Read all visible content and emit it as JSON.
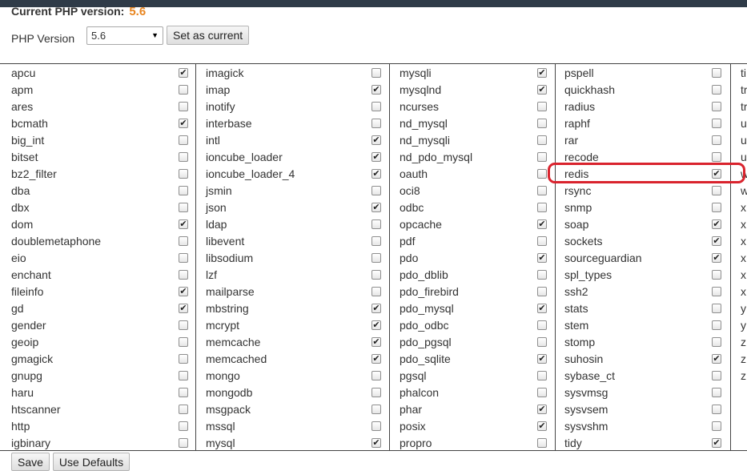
{
  "header": {
    "current_label": "Current PHP version:",
    "current_version": "5.6"
  },
  "selector": {
    "label": "PHP Version",
    "selected": "5.6",
    "set_button": "Set as current"
  },
  "columns": [
    [
      {
        "name": "apcu",
        "checked": true
      },
      {
        "name": "apm",
        "checked": false
      },
      {
        "name": "ares",
        "checked": false
      },
      {
        "name": "bcmath",
        "checked": true
      },
      {
        "name": "big_int",
        "checked": false
      },
      {
        "name": "bitset",
        "checked": false
      },
      {
        "name": "bz2_filter",
        "checked": false
      },
      {
        "name": "dba",
        "checked": false
      },
      {
        "name": "dbx",
        "checked": false
      },
      {
        "name": "dom",
        "checked": true
      },
      {
        "name": "doublemetaphone",
        "checked": false
      },
      {
        "name": "eio",
        "checked": false
      },
      {
        "name": "enchant",
        "checked": false
      },
      {
        "name": "fileinfo",
        "checked": true
      },
      {
        "name": "gd",
        "checked": true
      },
      {
        "name": "gender",
        "checked": false
      },
      {
        "name": "geoip",
        "checked": false
      },
      {
        "name": "gmagick",
        "checked": false
      },
      {
        "name": "gnupg",
        "checked": false
      },
      {
        "name": "haru",
        "checked": false
      },
      {
        "name": "htscanner",
        "checked": false
      },
      {
        "name": "http",
        "checked": false
      },
      {
        "name": "igbinary",
        "checked": false
      }
    ],
    [
      {
        "name": "imagick",
        "checked": false
      },
      {
        "name": "imap",
        "checked": true
      },
      {
        "name": "inotify",
        "checked": false
      },
      {
        "name": "interbase",
        "checked": false
      },
      {
        "name": "intl",
        "checked": true
      },
      {
        "name": "ioncube_loader",
        "checked": true
      },
      {
        "name": "ioncube_loader_4",
        "checked": true
      },
      {
        "name": "jsmin",
        "checked": false
      },
      {
        "name": "json",
        "checked": true
      },
      {
        "name": "ldap",
        "checked": false
      },
      {
        "name": "libevent",
        "checked": false
      },
      {
        "name": "libsodium",
        "checked": false
      },
      {
        "name": "lzf",
        "checked": false
      },
      {
        "name": "mailparse",
        "checked": false
      },
      {
        "name": "mbstring",
        "checked": true
      },
      {
        "name": "mcrypt",
        "checked": true
      },
      {
        "name": "memcache",
        "checked": true
      },
      {
        "name": "memcached",
        "checked": true
      },
      {
        "name": "mongo",
        "checked": false
      },
      {
        "name": "mongodb",
        "checked": false
      },
      {
        "name": "msgpack",
        "checked": false
      },
      {
        "name": "mssql",
        "checked": false
      },
      {
        "name": "mysql",
        "checked": true
      }
    ],
    [
      {
        "name": "mysqli",
        "checked": true
      },
      {
        "name": "mysqlnd",
        "checked": true
      },
      {
        "name": "ncurses",
        "checked": false
      },
      {
        "name": "nd_mysql",
        "checked": false
      },
      {
        "name": "nd_mysqli",
        "checked": false
      },
      {
        "name": "nd_pdo_mysql",
        "checked": false
      },
      {
        "name": "oauth",
        "checked": false
      },
      {
        "name": "oci8",
        "checked": false
      },
      {
        "name": "odbc",
        "checked": false
      },
      {
        "name": "opcache",
        "checked": true
      },
      {
        "name": "pdf",
        "checked": false
      },
      {
        "name": "pdo",
        "checked": true
      },
      {
        "name": "pdo_dblib",
        "checked": false
      },
      {
        "name": "pdo_firebird",
        "checked": false
      },
      {
        "name": "pdo_mysql",
        "checked": true
      },
      {
        "name": "pdo_odbc",
        "checked": false
      },
      {
        "name": "pdo_pgsql",
        "checked": false
      },
      {
        "name": "pdo_sqlite",
        "checked": true
      },
      {
        "name": "pgsql",
        "checked": false
      },
      {
        "name": "phalcon",
        "checked": false
      },
      {
        "name": "phar",
        "checked": true
      },
      {
        "name": "posix",
        "checked": true
      },
      {
        "name": "propro",
        "checked": false
      }
    ],
    [
      {
        "name": "pspell",
        "checked": false
      },
      {
        "name": "quickhash",
        "checked": false
      },
      {
        "name": "radius",
        "checked": false
      },
      {
        "name": "raphf",
        "checked": false
      },
      {
        "name": "rar",
        "checked": false
      },
      {
        "name": "recode",
        "checked": false
      },
      {
        "name": "redis",
        "checked": true
      },
      {
        "name": "rsync",
        "checked": false
      },
      {
        "name": "snmp",
        "checked": false
      },
      {
        "name": "soap",
        "checked": true
      },
      {
        "name": "sockets",
        "checked": true
      },
      {
        "name": "sourceguardian",
        "checked": true
      },
      {
        "name": "spl_types",
        "checked": false
      },
      {
        "name": "ssh2",
        "checked": false
      },
      {
        "name": "stats",
        "checked": false
      },
      {
        "name": "stem",
        "checked": false
      },
      {
        "name": "stomp",
        "checked": false
      },
      {
        "name": "suhosin",
        "checked": true
      },
      {
        "name": "sybase_ct",
        "checked": false
      },
      {
        "name": "sysvmsg",
        "checked": false
      },
      {
        "name": "sysvsem",
        "checked": false
      },
      {
        "name": "sysvshm",
        "checked": false
      },
      {
        "name": "tidy",
        "checked": true
      }
    ],
    [
      {
        "name": "ti",
        "checked": false
      },
      {
        "name": "tr",
        "checked": false
      },
      {
        "name": "tr",
        "checked": false
      },
      {
        "name": "u",
        "checked": false
      },
      {
        "name": "u",
        "checked": false
      },
      {
        "name": "u",
        "checked": false
      },
      {
        "name": "w",
        "checked": false
      },
      {
        "name": "w",
        "checked": false
      },
      {
        "name": "x",
        "checked": false
      },
      {
        "name": "x",
        "checked": false
      },
      {
        "name": "x",
        "checked": false
      },
      {
        "name": "x",
        "checked": false
      },
      {
        "name": "x",
        "checked": false
      },
      {
        "name": "x",
        "checked": false
      },
      {
        "name": "y",
        "checked": false
      },
      {
        "name": "y",
        "checked": false
      },
      {
        "name": "z",
        "checked": false
      },
      {
        "name": "z",
        "checked": false
      },
      {
        "name": "z",
        "checked": false
      }
    ]
  ],
  "footer": {
    "save": "Save",
    "defaults": "Use Defaults"
  },
  "colors": {
    "accent_version": "#e8851f",
    "highlight": "#d9232d",
    "topbar": "#2f3b48"
  },
  "check_glyph": "✔"
}
